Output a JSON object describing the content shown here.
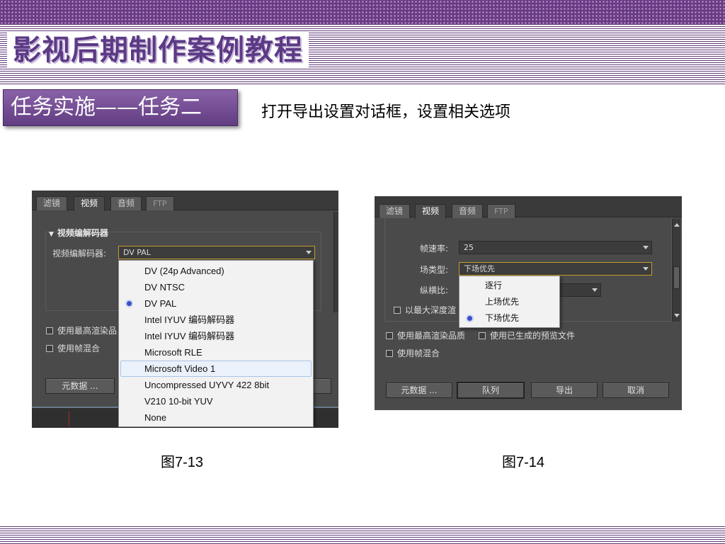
{
  "slide": {
    "title": "影视后期制作案例教程",
    "task_badge": "任务实施——任务二",
    "instruction": "打开导出设置对话框，设置相关选项"
  },
  "colors": {
    "theme_purple": "#6b3a86",
    "dialog_gray": "#4a4a4a",
    "focus_orange": "#c49a2c",
    "radio_blue": "#3a50c4"
  },
  "fig1": {
    "caption": "图7-13",
    "tabs": [
      "滤镜",
      "视频",
      "音频",
      "FTP"
    ],
    "active_tab": "视频",
    "section_header": "视频编解码器",
    "codec_label": "视频编解码器:",
    "codec_value": "DV PAL",
    "checkbox_max_quality": "使用最高渲染品",
    "checkbox_frame_blend": "使用帧混合",
    "metadata_button": "元数据 ...",
    "codec_options": [
      {
        "label": "DV (24p Advanced)",
        "selected": false
      },
      {
        "label": "DV NTSC",
        "selected": false
      },
      {
        "label": "DV PAL",
        "selected": true
      },
      {
        "label": "Intel IYUV 编码解码器",
        "selected": false
      },
      {
        "label": "Intel IYUV 编码解码器",
        "selected": false
      },
      {
        "label": "Microsoft RLE",
        "selected": false
      },
      {
        "label": "Microsoft Video 1",
        "selected": false,
        "hovered": true
      },
      {
        "label": "Uncompressed UYVY 422 8bit",
        "selected": false
      },
      {
        "label": "V210 10-bit YUV",
        "selected": false
      },
      {
        "label": "None",
        "selected": false
      }
    ]
  },
  "fig2": {
    "caption": "图7-14",
    "tabs": [
      "滤镜",
      "视频",
      "音频",
      "FTP"
    ],
    "active_tab": "视频",
    "frame_rate_label": "帧速率:",
    "frame_rate_value": "25",
    "field_type_label": "场类型:",
    "field_type_value": "下场优先",
    "aspect_label": "纵横比:",
    "max_depth_checkbox": "以最大深度渲",
    "checkbox_max_quality": "使用最高渲染品质",
    "checkbox_preview": "使用已生成的预览文件",
    "checkbox_frame_blend": "使用帧混合",
    "buttons": {
      "metadata": "元数据 ...",
      "queue": "队列",
      "export": "导出",
      "cancel": "取消"
    },
    "field_options": [
      {
        "label": "逐行",
        "selected": false
      },
      {
        "label": "上场优先",
        "selected": false
      },
      {
        "label": "下场优先",
        "selected": true
      }
    ]
  }
}
